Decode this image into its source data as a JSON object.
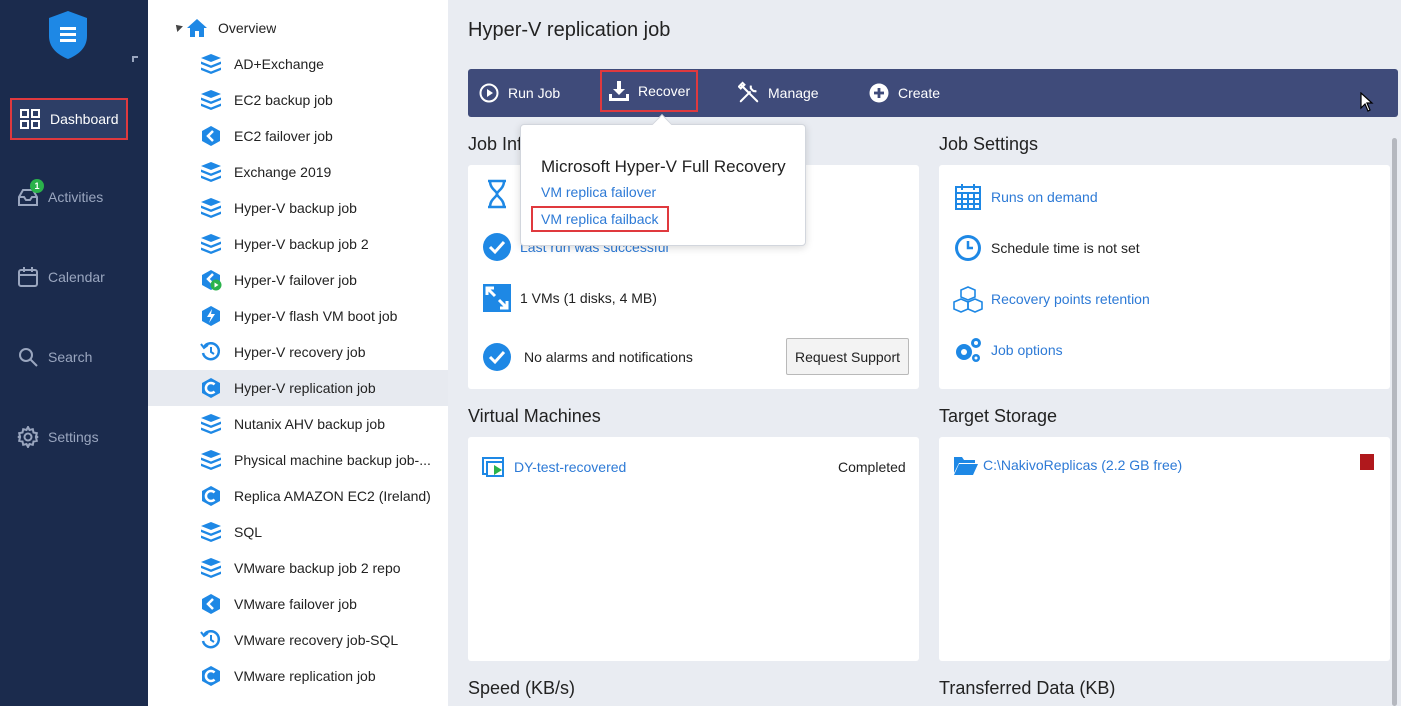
{
  "nav": {
    "items": [
      {
        "label": "Dashboard",
        "icon": "grid-icon",
        "active": true
      },
      {
        "label": "Activities",
        "icon": "inbox-icon",
        "badge": "1"
      },
      {
        "label": "Calendar",
        "icon": "calendar-icon"
      },
      {
        "label": "Search",
        "icon": "search-icon"
      },
      {
        "label": "Settings",
        "icon": "gear-icon"
      }
    ]
  },
  "tree": {
    "root": "Overview",
    "items": [
      {
        "label": "AD+Exchange",
        "icon": "backup-stack-icon"
      },
      {
        "label": "EC2 backup job",
        "icon": "backup-stack-icon"
      },
      {
        "label": "EC2 failover job",
        "icon": "failover-icon"
      },
      {
        "label": "Exchange 2019",
        "icon": "backup-stack-icon"
      },
      {
        "label": "Hyper-V backup job",
        "icon": "backup-stack-icon"
      },
      {
        "label": "Hyper-V backup job 2",
        "icon": "backup-stack-icon"
      },
      {
        "label": "Hyper-V failover job",
        "icon": "failover-run-icon"
      },
      {
        "label": "Hyper-V flash VM boot job",
        "icon": "flash-boot-icon"
      },
      {
        "label": "Hyper-V recovery job",
        "icon": "recovery-icon"
      },
      {
        "label": "Hyper-V replication job",
        "icon": "replication-icon",
        "selected": true
      },
      {
        "label": "Nutanix AHV backup job",
        "icon": "backup-stack-icon"
      },
      {
        "label": "Physical machine backup job-...",
        "icon": "backup-stack-icon"
      },
      {
        "label": "Replica AMAZON EC2 (Ireland)",
        "icon": "replication-icon"
      },
      {
        "label": "SQL",
        "icon": "backup-stack-icon"
      },
      {
        "label": "VMware backup job 2 repo",
        "icon": "backup-stack-icon"
      },
      {
        "label": "VMware failover job",
        "icon": "failover-icon"
      },
      {
        "label": "VMware recovery job-SQL",
        "icon": "recovery-icon"
      },
      {
        "label": "VMware replication job",
        "icon": "replication-icon"
      }
    ]
  },
  "main": {
    "title": "Hyper-V replication job",
    "toolbar": {
      "run": "Run Job",
      "recover": "Recover",
      "manage": "Manage",
      "create": "Create"
    },
    "popover": {
      "title": "Microsoft Hyper-V Full Recovery",
      "links": [
        "VM replica failover",
        "VM replica failback"
      ]
    },
    "job_info": {
      "title": "Job Info",
      "last_run": "Last run was successful",
      "vms": "1 VMs (1 disks, 4 MB)",
      "alarms": "No alarms and notifications",
      "request_support": "Request Support"
    },
    "job_settings": {
      "title": "Job Settings",
      "runs": "Runs on demand",
      "schedule": "Schedule time is not set",
      "retention": "Recovery points retention",
      "options": "Job options"
    },
    "virtual_machines": {
      "title": "Virtual Machines",
      "vm_name": "DY-test-recovered",
      "vm_status": "Completed"
    },
    "target_storage": {
      "title": "Target Storage",
      "path": "C:\\NakivoReplicas (2.2 GB free)"
    },
    "speed_title": "Speed (KB/s)",
    "transferred_title": "Transferred Data (KB)"
  },
  "colors": {
    "nav_bg": "#1b2b4d",
    "toolbar_bg": "#3f4b7a",
    "accent_blue": "#2d7ad6",
    "highlight_red": "#e0393e",
    "success_green": "#2ab24b"
  }
}
